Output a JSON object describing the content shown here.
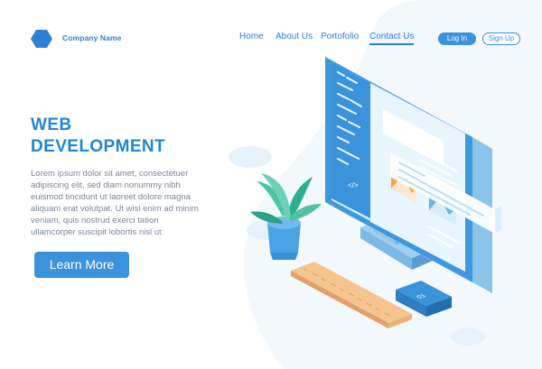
{
  "brand": {
    "name": "Company Name",
    "logo_icon": "hexagon-logo-icon"
  },
  "nav": {
    "items": [
      {
        "label": "Home"
      },
      {
        "label": "About Us"
      },
      {
        "label": "Portofolio"
      },
      {
        "label": "Contact Us",
        "active": true
      }
    ],
    "login": "Log In",
    "signup": "Sign Up"
  },
  "hero": {
    "title_line1": "WEB",
    "title_line2": "DEVELOPMENT",
    "description": "Lorem ipsum dolor sit amet, consectetuer adipiscing elit, sed diam nonummy nibh euismod tincidunt ut laoreet dolore magna aliquam erat volutpat. Ut wisi enim ad minim veniam, quis nostrud exerci tation ullamcorper suscipit lobortis nisl ut",
    "cta": "Learn More"
  },
  "illustration": {
    "icons": [
      "computer-monitor-icon",
      "plant-pot-icon",
      "ruler-icon",
      "code-key-icon"
    ],
    "code_symbol": "</>",
    "colors": {
      "primary": "#3a93db",
      "screen_light": "#cfe9fb",
      "orange": "#f5a64b",
      "plant": "#5cc3a6",
      "ruler": "#f6c48e"
    }
  },
  "colors": {
    "accent": "#2f80d4",
    "background": "#f3f8fd"
  }
}
